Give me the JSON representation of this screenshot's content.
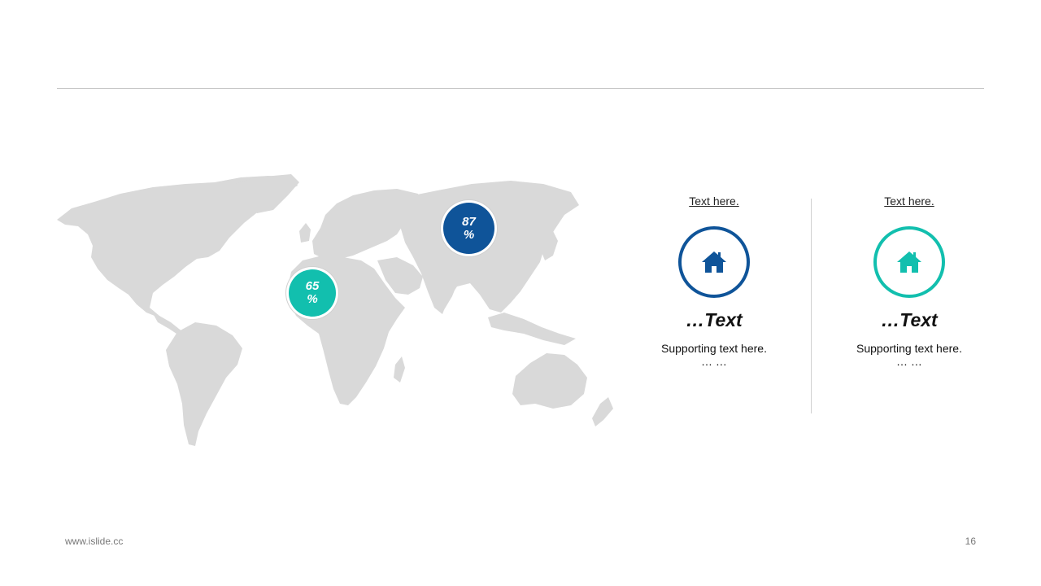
{
  "map": {
    "markers": [
      {
        "value": "87",
        "unit": "%",
        "color": "#0f5499"
      },
      {
        "value": "65",
        "unit": "%",
        "color": "#12bfae"
      }
    ]
  },
  "cards": [
    {
      "header": "Text here.",
      "icon": "home-icon",
      "title": "…Text",
      "text": "Supporting text here.",
      "ellipsis": "… …",
      "color": "#0f5499"
    },
    {
      "header": "Text here.",
      "icon": "home-icon",
      "title": "…Text",
      "text": "Supporting text here.",
      "ellipsis": "… …",
      "color": "#12bfae"
    }
  ],
  "footer": {
    "url": "www.islide.cc",
    "page": "16"
  }
}
